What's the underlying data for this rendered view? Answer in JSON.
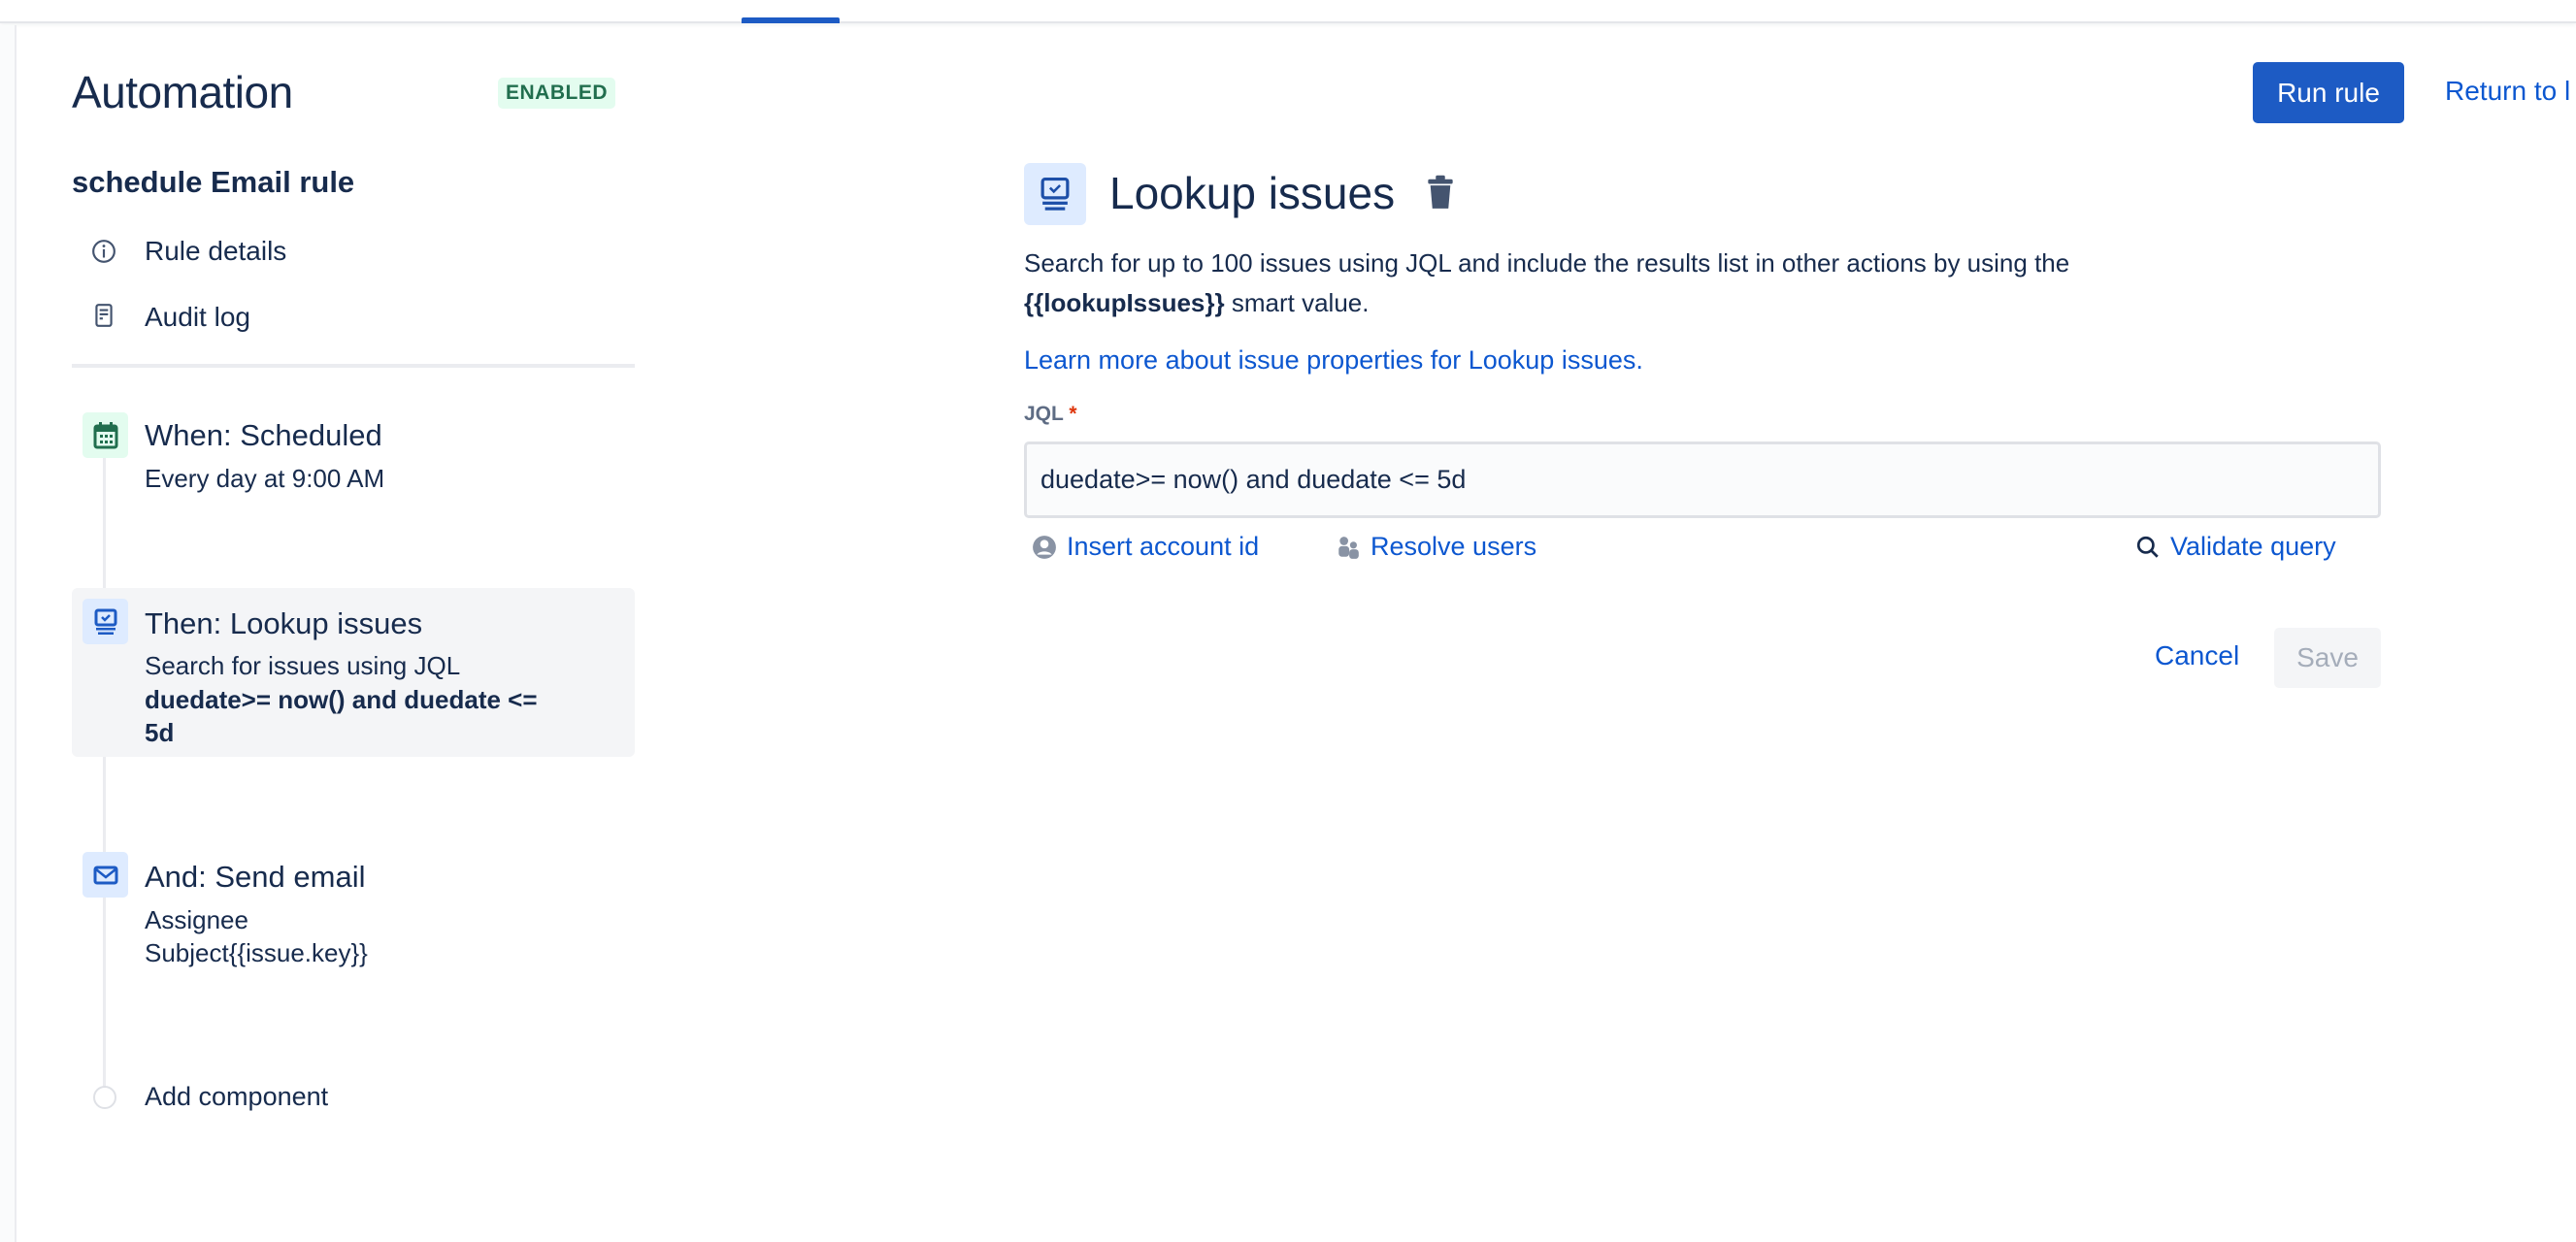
{
  "header": {
    "title": "Automation",
    "status_badge": "ENABLED",
    "run_rule": "Run rule",
    "return_link": "Return to l"
  },
  "sidebar": {
    "rule_name": "schedule Email rule",
    "nav": [
      {
        "label": "Rule details",
        "icon": "info-icon"
      },
      {
        "label": "Audit log",
        "icon": "audit-log-icon"
      }
    ],
    "steps": [
      {
        "title": "When: Scheduled",
        "lines": [
          "Every day at 9:00 AM"
        ],
        "icon": "calendar-icon",
        "color": "#216e4e"
      },
      {
        "title": "Then: Lookup issues",
        "lines": [
          "Search for issues using JQL",
          "duedate>= now() and duedate <=",
          "5d"
        ],
        "icon": "lookup-issues-icon",
        "selected": true
      },
      {
        "title": "And: Send email",
        "lines": [
          "Assignee",
          "Subject{{issue.key}}"
        ],
        "icon": "email-icon"
      }
    ],
    "add_component": "Add component"
  },
  "panel": {
    "title": "Lookup issues",
    "desc_line1": "Search for up to 100 issues using JQL and include the results list in other actions by using the",
    "desc_smart_value": "{{lookupIssues}}",
    "desc_line2_rest": " smart value.",
    "learn_more": "Learn more about issue properties for Lookup issues.",
    "jql_label": "JQL",
    "required_mark": "*",
    "jql_value": "duedate>= now() and duedate <= 5d",
    "insert_account_id": "Insert account id",
    "resolve_users": "Resolve users",
    "validate_query": "Validate query",
    "cancel": "Cancel",
    "save": "Save"
  },
  "colors": {
    "primary": "#1d5bc4",
    "link": "#0c57d0",
    "enabled_bg": "#e3fcef",
    "enabled_text": "#216e4e"
  }
}
